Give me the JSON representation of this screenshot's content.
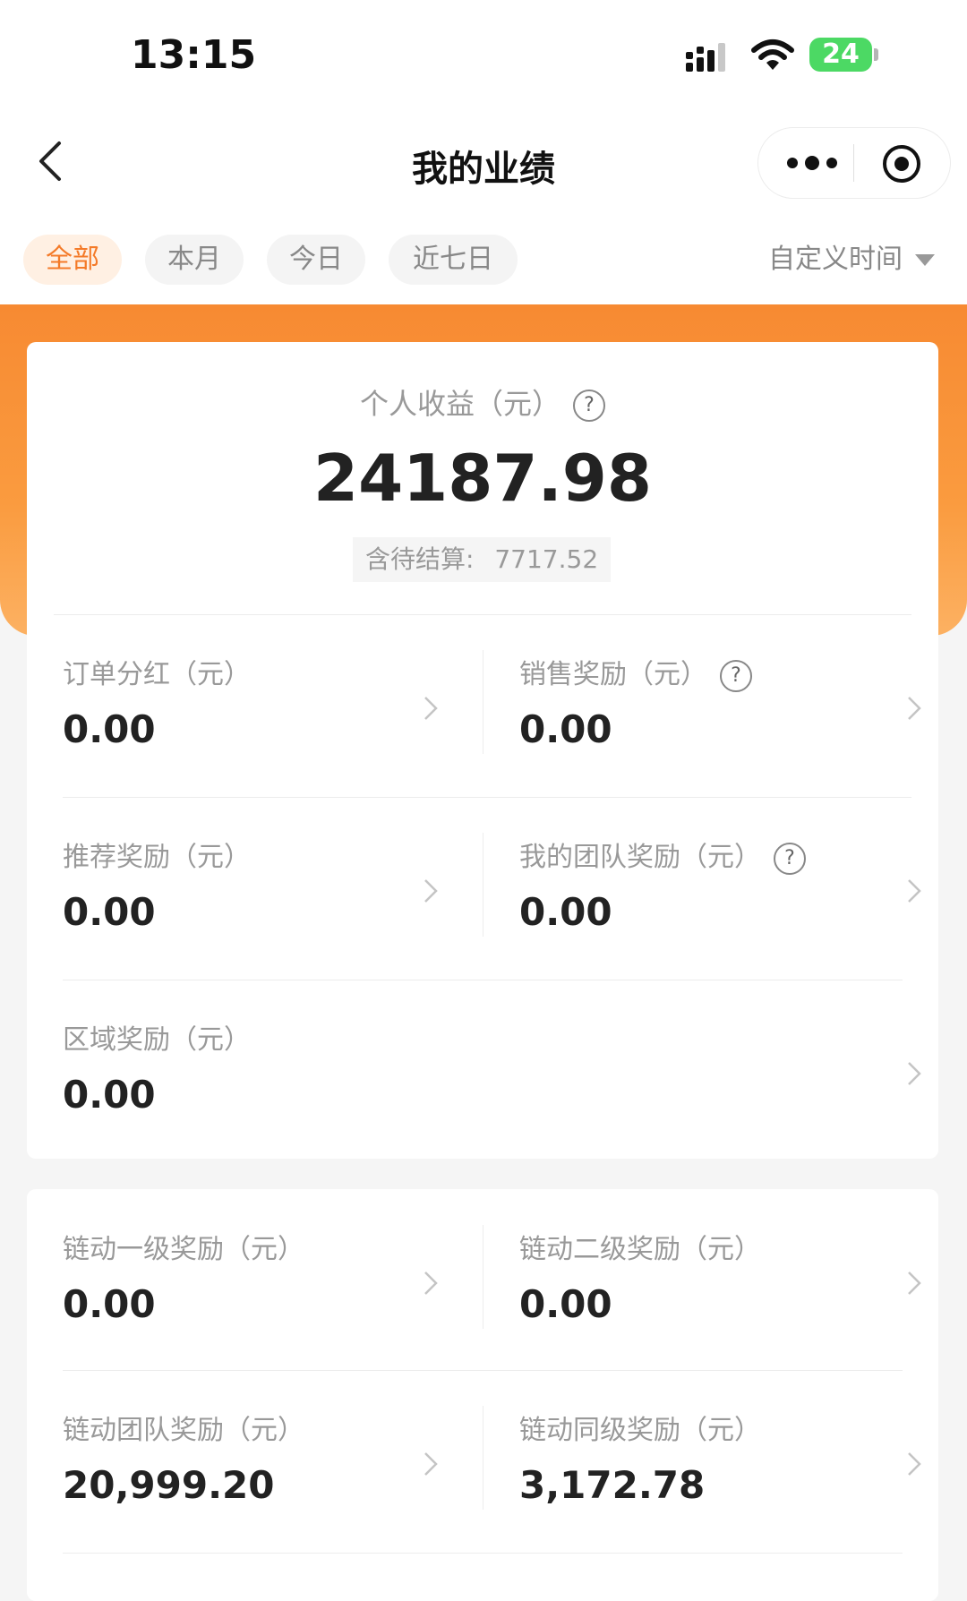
{
  "status": {
    "time": "13:15",
    "battery": "24"
  },
  "nav": {
    "title": "我的业绩"
  },
  "filters": {
    "tabs": [
      "全部",
      "本月",
      "今日",
      "近七日"
    ],
    "active": 0,
    "custom_label": "自定义时间"
  },
  "summary": {
    "label": "个人收益（元）",
    "help": "?",
    "value": "24187.98",
    "pending_label": "含待结算:",
    "pending_value": "7717.52"
  },
  "items": [
    {
      "label": "订单分红（元）",
      "value": "0.00",
      "help": false
    },
    {
      "label": "销售奖励（元）",
      "value": "0.00",
      "help": true
    },
    {
      "label": "推荐奖励（元）",
      "value": "0.00",
      "help": false
    },
    {
      "label": "我的团队奖励（元）",
      "value": "0.00",
      "help": true
    },
    {
      "label": "区域奖励（元）",
      "value": "0.00",
      "help": false
    }
  ],
  "items2": [
    {
      "label": "链动一级奖励（元）",
      "value": "0.00"
    },
    {
      "label": "链动二级奖励（元）",
      "value": "0.00"
    },
    {
      "label": "链动团队奖励（元）",
      "value": "20,999.20"
    },
    {
      "label": "链动同级奖励（元）",
      "value": "3,172.78"
    }
  ],
  "colors": {
    "accent": "#f47a28",
    "band": "#f78a32",
    "battery": "#4cd964"
  }
}
